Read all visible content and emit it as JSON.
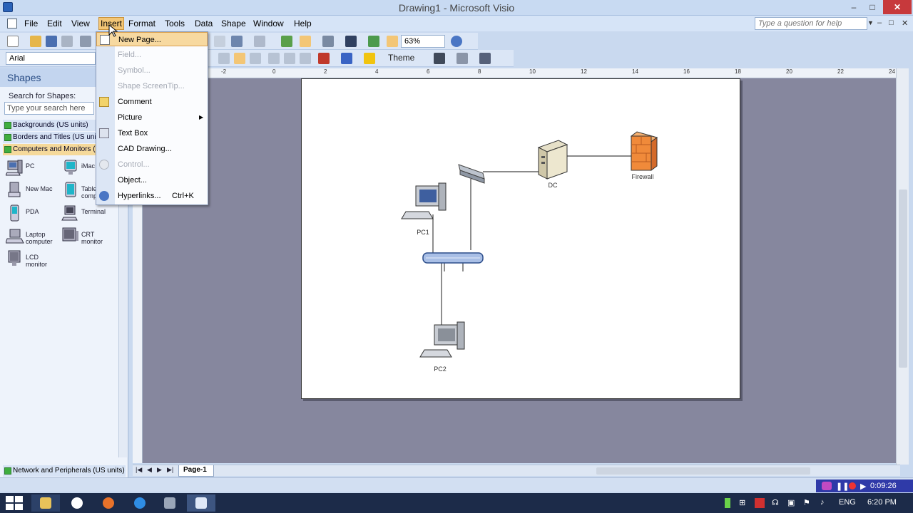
{
  "window": {
    "title": "Drawing1 - Microsoft Visio",
    "minimize": "–",
    "maximize": "□",
    "close": "✕"
  },
  "menubar": {
    "items": [
      "File",
      "Edit",
      "View",
      "Insert",
      "Format",
      "Tools",
      "Data",
      "Shape",
      "Window",
      "Help"
    ],
    "active": "Insert",
    "help_placeholder": "Type a question for help",
    "doc_controls": [
      "–",
      "□",
      "✕"
    ]
  },
  "toolbar": {
    "font": "Arial",
    "zoom": "63%",
    "theme_label": "Theme"
  },
  "insert_menu": {
    "items": [
      {
        "label": "New Page...",
        "icon": "new-page-icon",
        "disabled": false
      },
      {
        "label": "Field...",
        "icon": "",
        "disabled": true
      },
      {
        "label": "Symbol...",
        "icon": "",
        "disabled": true
      },
      {
        "label": "Shape ScreenTip...",
        "icon": "",
        "disabled": true
      },
      {
        "label": "Comment",
        "icon": "comment-icon",
        "disabled": false
      },
      {
        "label": "Picture",
        "icon": "",
        "disabled": false,
        "submenu": true
      },
      {
        "label": "Text Box",
        "icon": "text-box-icon",
        "disabled": false
      },
      {
        "label": "CAD Drawing...",
        "icon": "",
        "disabled": false
      },
      {
        "label": "Control...",
        "icon": "control-icon",
        "disabled": true
      },
      {
        "label": "Object...",
        "icon": "",
        "disabled": false
      },
      {
        "label": "Hyperlinks...",
        "icon": "hyperlink-icon",
        "disabled": false,
        "shortcut": "Ctrl+K"
      }
    ]
  },
  "shapes_panel": {
    "title": "Shapes",
    "search_label": "Search for Shapes:",
    "search_placeholder": "Type your search here",
    "stencils": [
      "Backgrounds (US units)",
      "Borders and Titles (US units)",
      "Computers and Monitors (US units)"
    ],
    "bottom_stencil": "Network and Peripherals (US units)",
    "shapes": [
      {
        "label": "PC"
      },
      {
        "label": "iMac"
      },
      {
        "label": "New Mac"
      },
      {
        "label": "Tablet computer"
      },
      {
        "label": "PDA"
      },
      {
        "label": "Terminal"
      },
      {
        "label": "Laptop computer"
      },
      {
        "label": "CRT monitor"
      },
      {
        "label": "LCD monitor"
      }
    ]
  },
  "ruler": {
    "top": [
      "-2",
      "0",
      "2",
      "4",
      "6",
      "8",
      "10",
      "12",
      "14",
      "16",
      "18",
      "20",
      "22",
      "24"
    ]
  },
  "diagram": {
    "labels": {
      "pc1": "PC1",
      "pc2": "PC2",
      "dc": "DC",
      "firewall": "Firewall"
    }
  },
  "page_tabs": {
    "active": "Page-1"
  },
  "recorder": {
    "time": "0:09:26"
  },
  "taskbar": {
    "language": "ENG",
    "clock": "6:20 PM"
  }
}
